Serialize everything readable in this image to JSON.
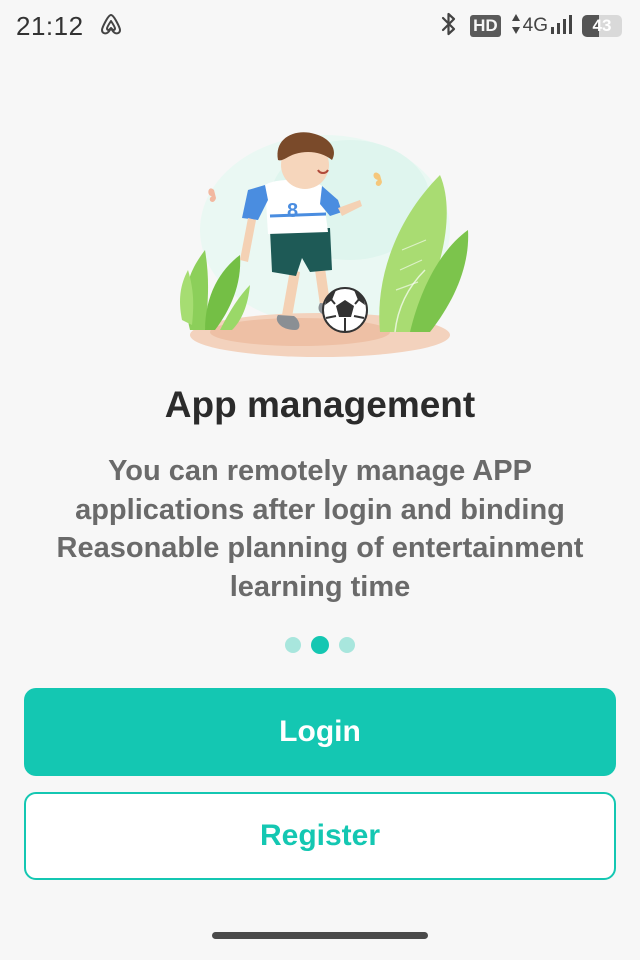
{
  "status_bar": {
    "time": "21:12",
    "hd": "HD",
    "network": "4G",
    "battery_level": 43,
    "battery_text": "43",
    "icons": [
      "airbnb-like-app-icon",
      "bluetooth-icon",
      "hd-icon",
      "data-arrows-icon",
      "signal-icon",
      "battery-icon"
    ]
  },
  "illustration": {
    "description_icon": "boy-playing-soccer-illustration",
    "jersey_number": "8"
  },
  "onboarding": {
    "title": "App management",
    "description_lines": [
      "You can remotely manage APP",
      "applications after login and binding",
      "Reasonable planning of entertainment",
      "learning time"
    ],
    "page_indicator": {
      "total": 3,
      "active_index": 1
    }
  },
  "actions": {
    "login_label": "Login",
    "register_label": "Register"
  },
  "colors": {
    "accent": "#14c7b2",
    "accent_light": "#a8e6dd",
    "background": "#f7f7f7",
    "title": "#2b2b2b",
    "description": "#6a6a6a"
  }
}
